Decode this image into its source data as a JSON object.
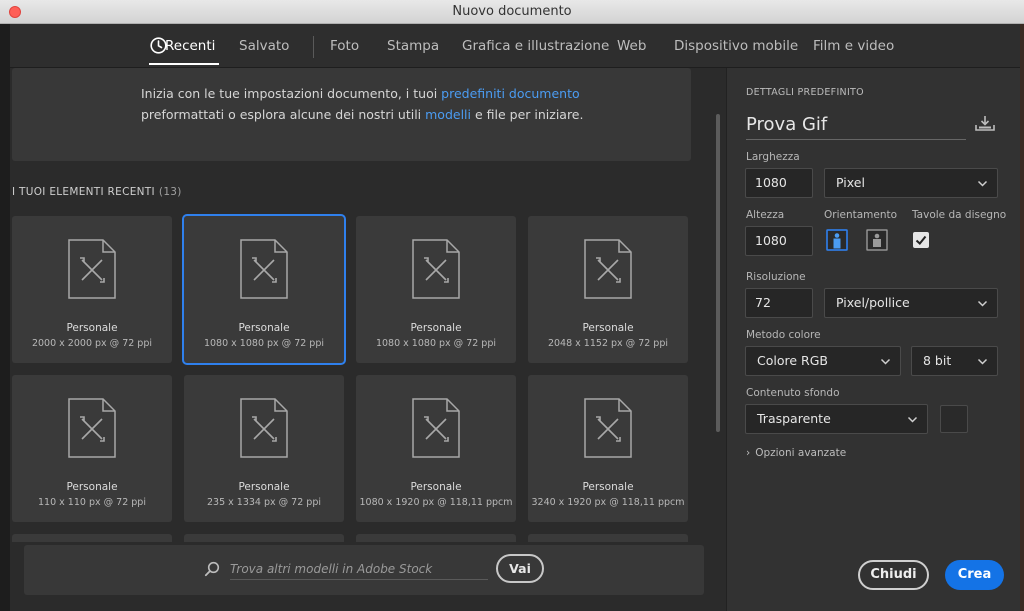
{
  "window": {
    "title": "Nuovo documento"
  },
  "nav": {
    "tabs": [
      {
        "label": "Recenti"
      },
      {
        "label": "Salvato"
      },
      {
        "label": "Foto"
      },
      {
        "label": "Stampa"
      },
      {
        "label": "Grafica e illustrazione"
      },
      {
        "label": "Web"
      },
      {
        "label": "Dispositivo mobile"
      },
      {
        "label": "Film e video"
      }
    ],
    "icon": "clock-icon"
  },
  "intro": {
    "line1_a": "Inizia con le tue impostazioni documento, i tuoi ",
    "link1": "predefiniti documento",
    "line2_a": "preformattati o esplora alcune dei nostri utili ",
    "link2": "modelli",
    "line2_b": " e file per iniziare."
  },
  "recent": {
    "label": "I TUOI ELEMENTI RECENTI",
    "count": "(13)",
    "items": [
      {
        "name": "Personale",
        "dims": "2000 x 2000 px @ 72 ppi"
      },
      {
        "name": "Personale",
        "dims": "1080 x 1080 px @ 72 ppi"
      },
      {
        "name": "Personale",
        "dims": "1080 x 1080 px @ 72 ppi"
      },
      {
        "name": "Personale",
        "dims": "2048 x 1152 px @ 72 ppi"
      },
      {
        "name": "Personale",
        "dims": "110 x 110 px @ 72 ppi"
      },
      {
        "name": "Personale",
        "dims": "235 x 1334 px @ 72 ppi"
      },
      {
        "name": "Personale",
        "dims": "1080 x 1920 px @ 118,11 ppcm"
      },
      {
        "name": "Personale",
        "dims": "3240 x 1920 px @ 118,11 ppcm"
      }
    ],
    "selected_index": 1
  },
  "stock": {
    "placeholder": "Trova altri modelli in Adobe Stock",
    "button": "Vai"
  },
  "details": {
    "heading": "DETTAGLI PREDEFINITO",
    "preset_name": "Prova Gif",
    "width_label": "Larghezza",
    "width_value": "1080",
    "width_unit": "Pixel",
    "height_label": "Altezza",
    "height_value": "1080",
    "orientation_label": "Orientamento",
    "artboards_label": "Tavole da disegno",
    "artboards_checked": true,
    "resolution_label": "Risoluzione",
    "resolution_value": "72",
    "resolution_unit": "Pixel/pollice",
    "color_mode_label": "Metodo colore",
    "color_mode_value": "Colore RGB",
    "bit_depth_value": "8 bit",
    "background_label": "Contenuto sfondo",
    "background_value": "Trasparente",
    "advanced_label": "Opzioni avanzate",
    "close_button": "Chiudi",
    "create_button": "Crea"
  },
  "colors": {
    "accent": "#1473e6",
    "link": "#4b9cf2",
    "selection": "#2f80ed",
    "close_dot": "#fe5f57"
  }
}
